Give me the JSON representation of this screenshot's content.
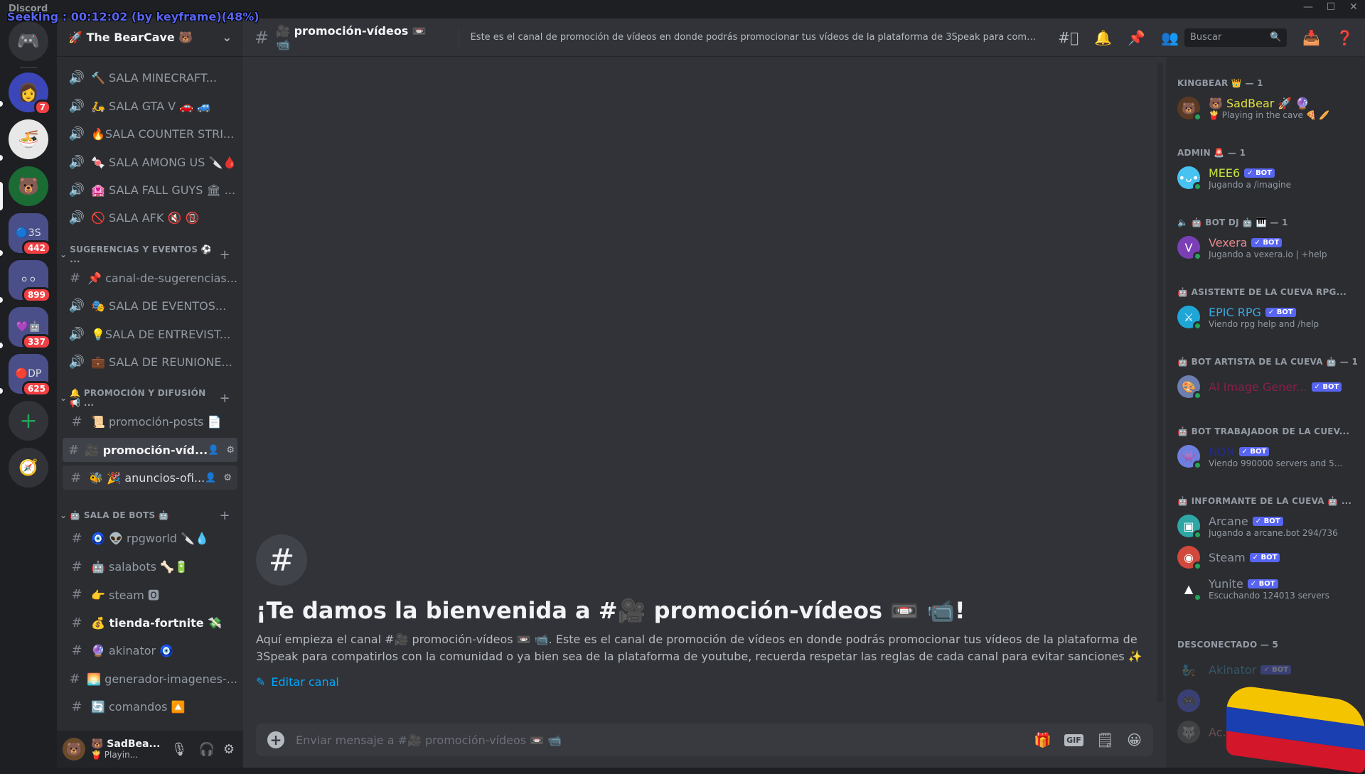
{
  "overlay": {
    "seek_text": "Seeking : 00:12:02 (by keyframe)(48%)"
  },
  "titlebar": {
    "app_name": "Discord",
    "minimize": "—",
    "maximize": "☐",
    "close": "✕"
  },
  "rail": {
    "home_icon": "discord-home",
    "servers": [
      {
        "name": "server-anime",
        "badge": "7"
      },
      {
        "name": "server-ramen",
        "badge": ""
      },
      {
        "name": "server-bearcave",
        "badge": ""
      },
      {
        "name": "folder-1",
        "badge": "442"
      },
      {
        "name": "folder-2",
        "badge": "899"
      },
      {
        "name": "folder-3",
        "badge": "337"
      },
      {
        "name": "folder-4",
        "badge": "625"
      }
    ],
    "add_server": "+",
    "explore": "🧭"
  },
  "guild": {
    "name": "🚀 The BearCave 🐻",
    "chevron": "⌄"
  },
  "channels": {
    "voice_top": [
      {
        "label": "🔨 SALA MINECRAFT..."
      },
      {
        "label": "🛵 SALA GTA V 🚗 🚙"
      },
      {
        "label": "🔥SALA COUNTER STRI..."
      },
      {
        "label": "🍬 SALA AMONG US 🔪🩸"
      },
      {
        "label": "🏩 SALA FALL GUYS 🏛 ..."
      },
      {
        "label": "🚫 SALA AFK 🔇 📵"
      }
    ],
    "categories": [
      {
        "label": "SUGERENCIAS Y EVENTOS ⚽ ...",
        "items": [
          {
            "type": "text",
            "label": "📌 canal-de-sugerencias..."
          },
          {
            "type": "voice",
            "label": "🎭 SALA DE EVENTOS..."
          },
          {
            "type": "voice",
            "label": "💡SALA DE ENTREVIST..."
          },
          {
            "type": "voice",
            "label": "💼 SALA DE REUNIONE..."
          }
        ]
      },
      {
        "label": "🔔 PROMOCIÓN Y DIFUSIÓN 📢 ...",
        "items": [
          {
            "type": "text",
            "label": "📜 promoción-posts 📄"
          },
          {
            "type": "text",
            "label": "🎥 promoción-víd...",
            "selected": true
          },
          {
            "type": "text",
            "label": "🐝 🎉 anuncios-ofi...",
            "hover": true
          }
        ]
      },
      {
        "label": "🤖 SALA DE BOTS 🤖",
        "items": [
          {
            "type": "text",
            "label": "🧿 👽 rpgworld 🔪💧"
          },
          {
            "type": "text",
            "label": "🤖 salabots 🦴🔋"
          },
          {
            "type": "text",
            "label": "👉 steam 🅾"
          },
          {
            "type": "text",
            "label": "💰 tienda-fortnite 💸",
            "unread": true
          },
          {
            "type": "text",
            "label": "🔮 akinator 🧿"
          },
          {
            "type": "text",
            "label": "🌅 generador-imagenes-..."
          },
          {
            "type": "text",
            "label": "🔄 comandos 🔼"
          }
        ]
      }
    ]
  },
  "user_panel": {
    "name": "🐻 SadBea...",
    "status": "🍟 Playin...",
    "mic": "🎙",
    "headset": "🎧",
    "settings": "⚙"
  },
  "header": {
    "channel_name": "🎥 promoción-vídeos 📼 📹",
    "topic": "Este es el canal de promoción de vídeos en donde podrás promocionar tus vídeos de la plataforma de 3Speak para compati...",
    "search_placeholder": "Buscar"
  },
  "welcome": {
    "title": "¡Te damos la bienvenida a #🎥 promoción-vídeos 📼 📹!",
    "description": "Aquí empieza el canal #🎥 promoción-vídeos 📼 📹. Este es el canal de promoción de vídeos en donde podrás promocionar tus vídeos de la plataforma de 3Speak para compatirlos con la comunidad o ya bien sea de la plataforma de youtube, recuerda respetar las reglas de cada canal para evitar sanciones ✨",
    "edit_label": "Editar canal"
  },
  "composer": {
    "placeholder": "Enviar mensaje a #🎥 promoción-vídeos 📼 📹"
  },
  "members": {
    "groups": [
      {
        "label": "KINGBEAR 👑 — 1",
        "members": [
          {
            "name": "🐻 SadBear 🚀 🔮",
            "status": "🍟 Playing in the cave 🍕 🥖",
            "color": "#e3e03b",
            "bot": false,
            "avatar": "🐻",
            "avbg": "#5a3a22"
          }
        ]
      },
      {
        "label": "ADMIN 🚨 — 1",
        "members": [
          {
            "name": "MEE6",
            "status": "Jugando a /imagine",
            "color": "#c7e23a",
            "bot": true,
            "avatar": "•ᴗ•",
            "avbg": "#48c2f0"
          }
        ]
      },
      {
        "label": "🔈 🤖 BOT DJ 🤖 🎹 — 1",
        "members": [
          {
            "name": "Vexera",
            "status": "Jugando a vexera.io | +help",
            "color": "#e88a8a",
            "bot": true,
            "avatar": "V",
            "avbg": "#7b3fb5"
          }
        ]
      },
      {
        "label": "🤖 ASISTENTE DE LA CUEVA RPG...",
        "members": [
          {
            "name": "EPIC RPG",
            "status": "Viendo rpg help and /help",
            "color": "#3aa7e0",
            "bot": true,
            "avatar": "⚔",
            "avbg": "#1fa6d6"
          }
        ]
      },
      {
        "label": "🤖 BOT ARTISTA DE LA CUEVA 🤖 — 1",
        "members": [
          {
            "name": "AI Image Gener...",
            "status": "",
            "color": "#8a1f4a",
            "bot": true,
            "avatar": "🎨",
            "avbg": "#6c7fb0"
          }
        ]
      },
      {
        "label": "🤖 BOT TRABAJADOR DE LA CUEV...",
        "members": [
          {
            "name": "NQN",
            "status": "Viendo 990000 servers and 5...",
            "color": "#1f2b8a",
            "bot": true,
            "avatar": "👾",
            "avbg": "#6f7fe0"
          }
        ]
      },
      {
        "label": "🤖 INFORMANTE DE LA CUEVA 🤖 ...",
        "members": [
          {
            "name": "Arcane",
            "status": "Jugando a arcane.bot 294/736",
            "color": "#8f96a3",
            "bot": true,
            "avatar": "▣",
            "avbg": "#2fa6a6"
          },
          {
            "name": "Steam",
            "status": "",
            "color": "#8f96a3",
            "bot": true,
            "avatar": "◉",
            "avbg": "#d0493c"
          },
          {
            "name": "Yunite",
            "status": "Escuchando 124013 servers",
            "color": "#8f96a3",
            "bot": true,
            "avatar": "▲",
            "avbg": "#2b2d31"
          }
        ]
      },
      {
        "label": "DESCONECTADO — 5",
        "members": [
          {
            "name": "Akinator",
            "status": "",
            "color": "#4aa3c8",
            "bot": true,
            "avatar": "🧞",
            "avbg": "#2b2d31"
          },
          {
            "name": "",
            "status": "",
            "color": "#8f96a3",
            "bot": false,
            "avatar": "🎮",
            "avbg": "#5865f2"
          },
          {
            "name": "Ac...",
            "status": "",
            "color": "#e88a8a",
            "bot": false,
            "avatar": "🐺",
            "avbg": "#666"
          }
        ]
      }
    ]
  },
  "bot_tag": "✓ BOT"
}
